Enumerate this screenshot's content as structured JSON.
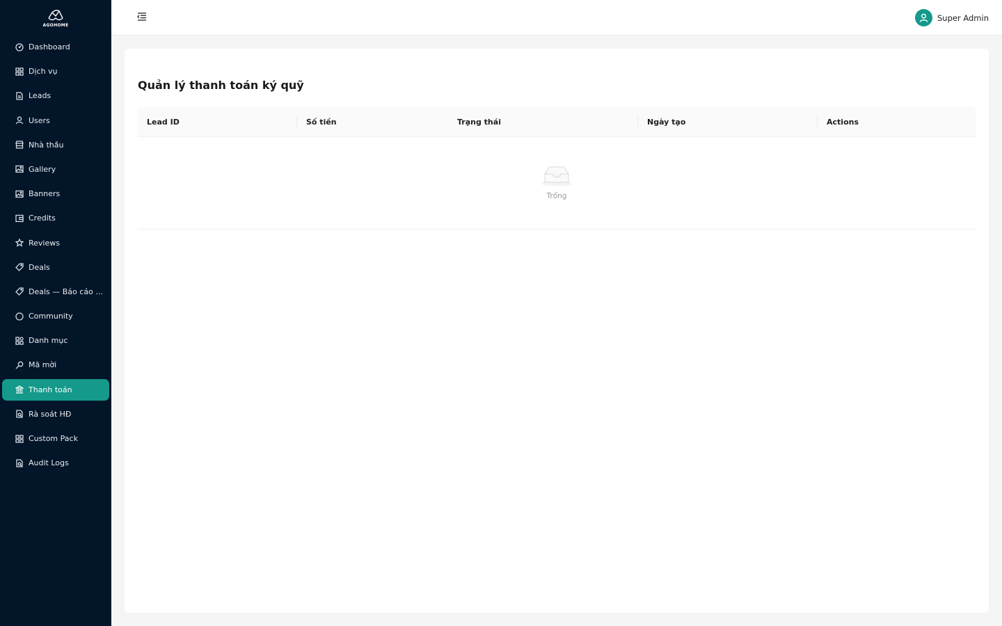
{
  "brand": {
    "logo_text": "AGOHOME"
  },
  "sidebar": {
    "items": [
      {
        "label": "Dashboard",
        "icon": "dashboard-icon"
      },
      {
        "label": "Dịch vụ",
        "icon": "grid-icon"
      },
      {
        "label": "Leads",
        "icon": "file-icon"
      },
      {
        "label": "Users",
        "icon": "user-icon"
      },
      {
        "label": "Nhà thầu",
        "icon": "shop-icon"
      },
      {
        "label": "Gallery",
        "icon": "picture-icon"
      },
      {
        "label": "Banners",
        "icon": "picture-icon"
      },
      {
        "label": "Credits",
        "icon": "wallet-icon"
      },
      {
        "label": "Reviews",
        "icon": "star-icon"
      },
      {
        "label": "Deals",
        "icon": "tag-icon"
      },
      {
        "label": "Deals — Báo cáo ...",
        "icon": "tag-icon"
      },
      {
        "label": "Community",
        "icon": "message-icon"
      },
      {
        "label": "Danh mục",
        "icon": "category-icon"
      },
      {
        "label": "Mã mời",
        "icon": "key-icon"
      },
      {
        "label": "Thanh toán",
        "icon": "bank-icon",
        "active": true
      },
      {
        "label": "Rà soát HĐ",
        "icon": "file-search-icon"
      },
      {
        "label": "Custom Pack",
        "icon": "grid-icon"
      },
      {
        "label": "Audit Logs",
        "icon": "file-search-icon"
      }
    ]
  },
  "header": {
    "user_name": "Super Admin"
  },
  "main": {
    "title": "Quản lý thanh toán ký quỹ",
    "table": {
      "columns": [
        "Lead ID",
        "Số tiền",
        "Trạng thái",
        "Ngày tạo",
        "Actions"
      ],
      "empty_text": "Trống"
    }
  },
  "colors": {
    "sidebar_bg": "#031529",
    "accent": "#14998a"
  }
}
